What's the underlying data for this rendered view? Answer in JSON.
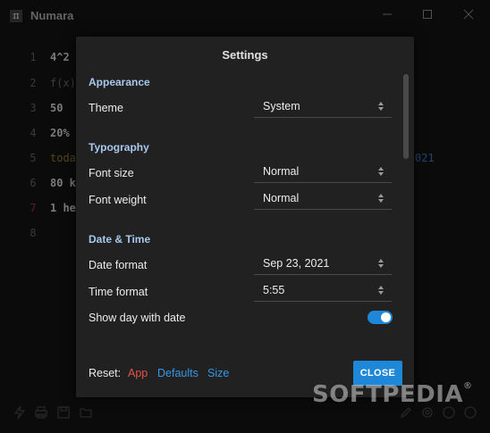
{
  "window": {
    "title": "Numara",
    "logo_glyph": "π"
  },
  "editor": {
    "lines": [
      {
        "num": "1",
        "text": "4^2"
      },
      {
        "num": "2",
        "text": "f(x)"
      },
      {
        "num": "3",
        "text": "50"
      },
      {
        "num": "4",
        "text": "20%"
      },
      {
        "num": "5",
        "text": "toda"
      },
      {
        "num": "6",
        "text": "80 k"
      },
      {
        "num": "7",
        "text": "1 he"
      },
      {
        "num": "8",
        "text": ""
      }
    ],
    "visible_result": "021"
  },
  "settings": {
    "title": "Settings",
    "appearance": {
      "heading": "Appearance",
      "theme_label": "Theme",
      "theme_value": "System"
    },
    "typography": {
      "heading": "Typography",
      "font_size_label": "Font size",
      "font_size_value": "Normal",
      "font_weight_label": "Font weight",
      "font_weight_value": "Normal"
    },
    "datetime": {
      "heading": "Date & Time",
      "date_format_label": "Date format",
      "date_format_value": "Sep 23, 2021",
      "time_format_label": "Time format",
      "time_format_value": "5:55",
      "show_day_label": "Show day with date",
      "show_day_enabled": true
    },
    "reset": {
      "label": "Reset:",
      "app": "App",
      "defaults": "Defaults",
      "size": "Size"
    },
    "close_label": "CLOSE"
  },
  "watermark": {
    "text": "SOFTPEDIA",
    "mark": "®"
  },
  "colors": {
    "accent": "#1e87d8",
    "section_heading": "#a8c8ee",
    "reset_app": "#e0554a",
    "link": "#3a95e4"
  }
}
